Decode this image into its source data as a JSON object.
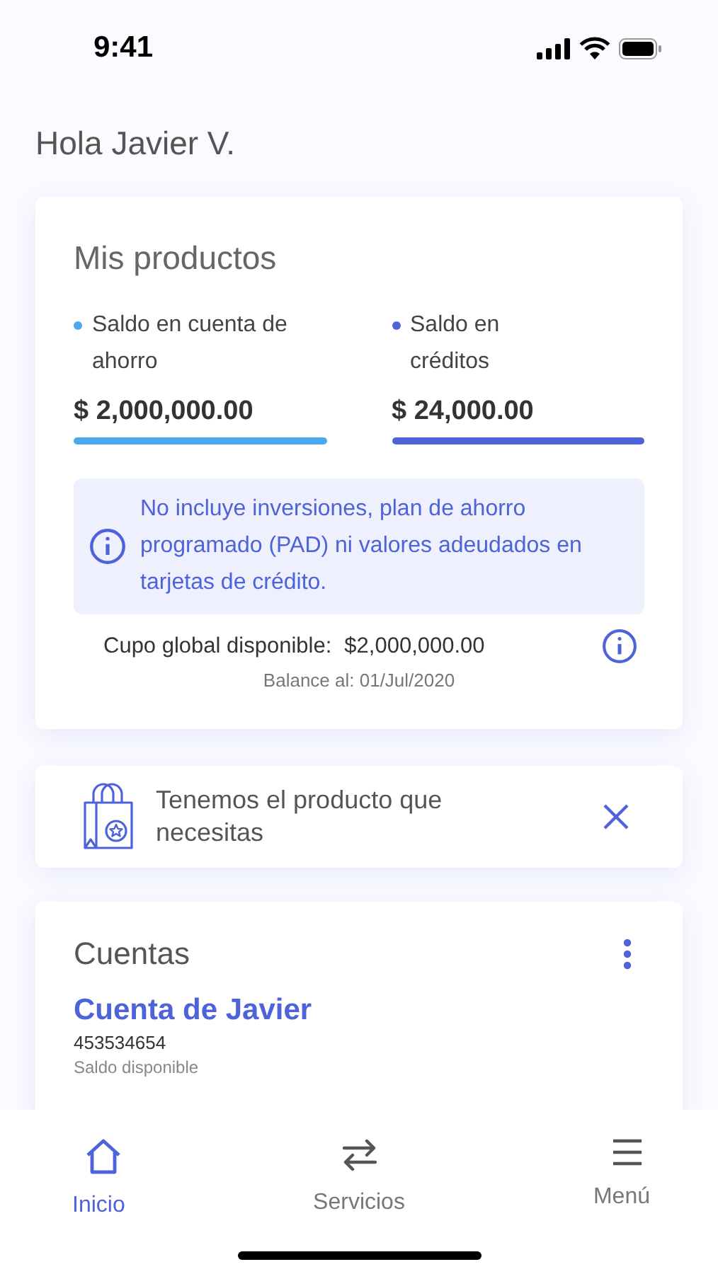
{
  "status_bar": {
    "time": "9:41"
  },
  "greeting": "Hola Javier V.",
  "products": {
    "title": "Mis productos",
    "balances": [
      {
        "label": "Saldo en cuenta de ahorro",
        "amount": "$ 2,000,000.00",
        "color": "#4aa8ec"
      },
      {
        "label": "Saldo en créditos",
        "amount": "$ 24,000.00",
        "color": "#4f63d9"
      }
    ],
    "notice": "No incluye inversiones, plan de ahorro programado (PAD) ni valores adeudados en tarjetas de crédito.",
    "global_label": "Cupo global disponible:",
    "global_amount": "$2,000,000.00",
    "balance_date": "Balance al: 01/Jul/2020"
  },
  "promo": {
    "text": "Tenemos el producto que necesitas"
  },
  "accounts": {
    "title": "Cuentas",
    "name": "Cuenta de Javier",
    "number": "453534654",
    "available_label": "Saldo disponible"
  },
  "nav": [
    {
      "label": "Inicio",
      "kind": "home",
      "selected": true
    },
    {
      "label": "Servicios",
      "kind": "transfer",
      "selected": false
    },
    {
      "label": "Menú",
      "kind": "menu",
      "selected": false
    }
  ]
}
